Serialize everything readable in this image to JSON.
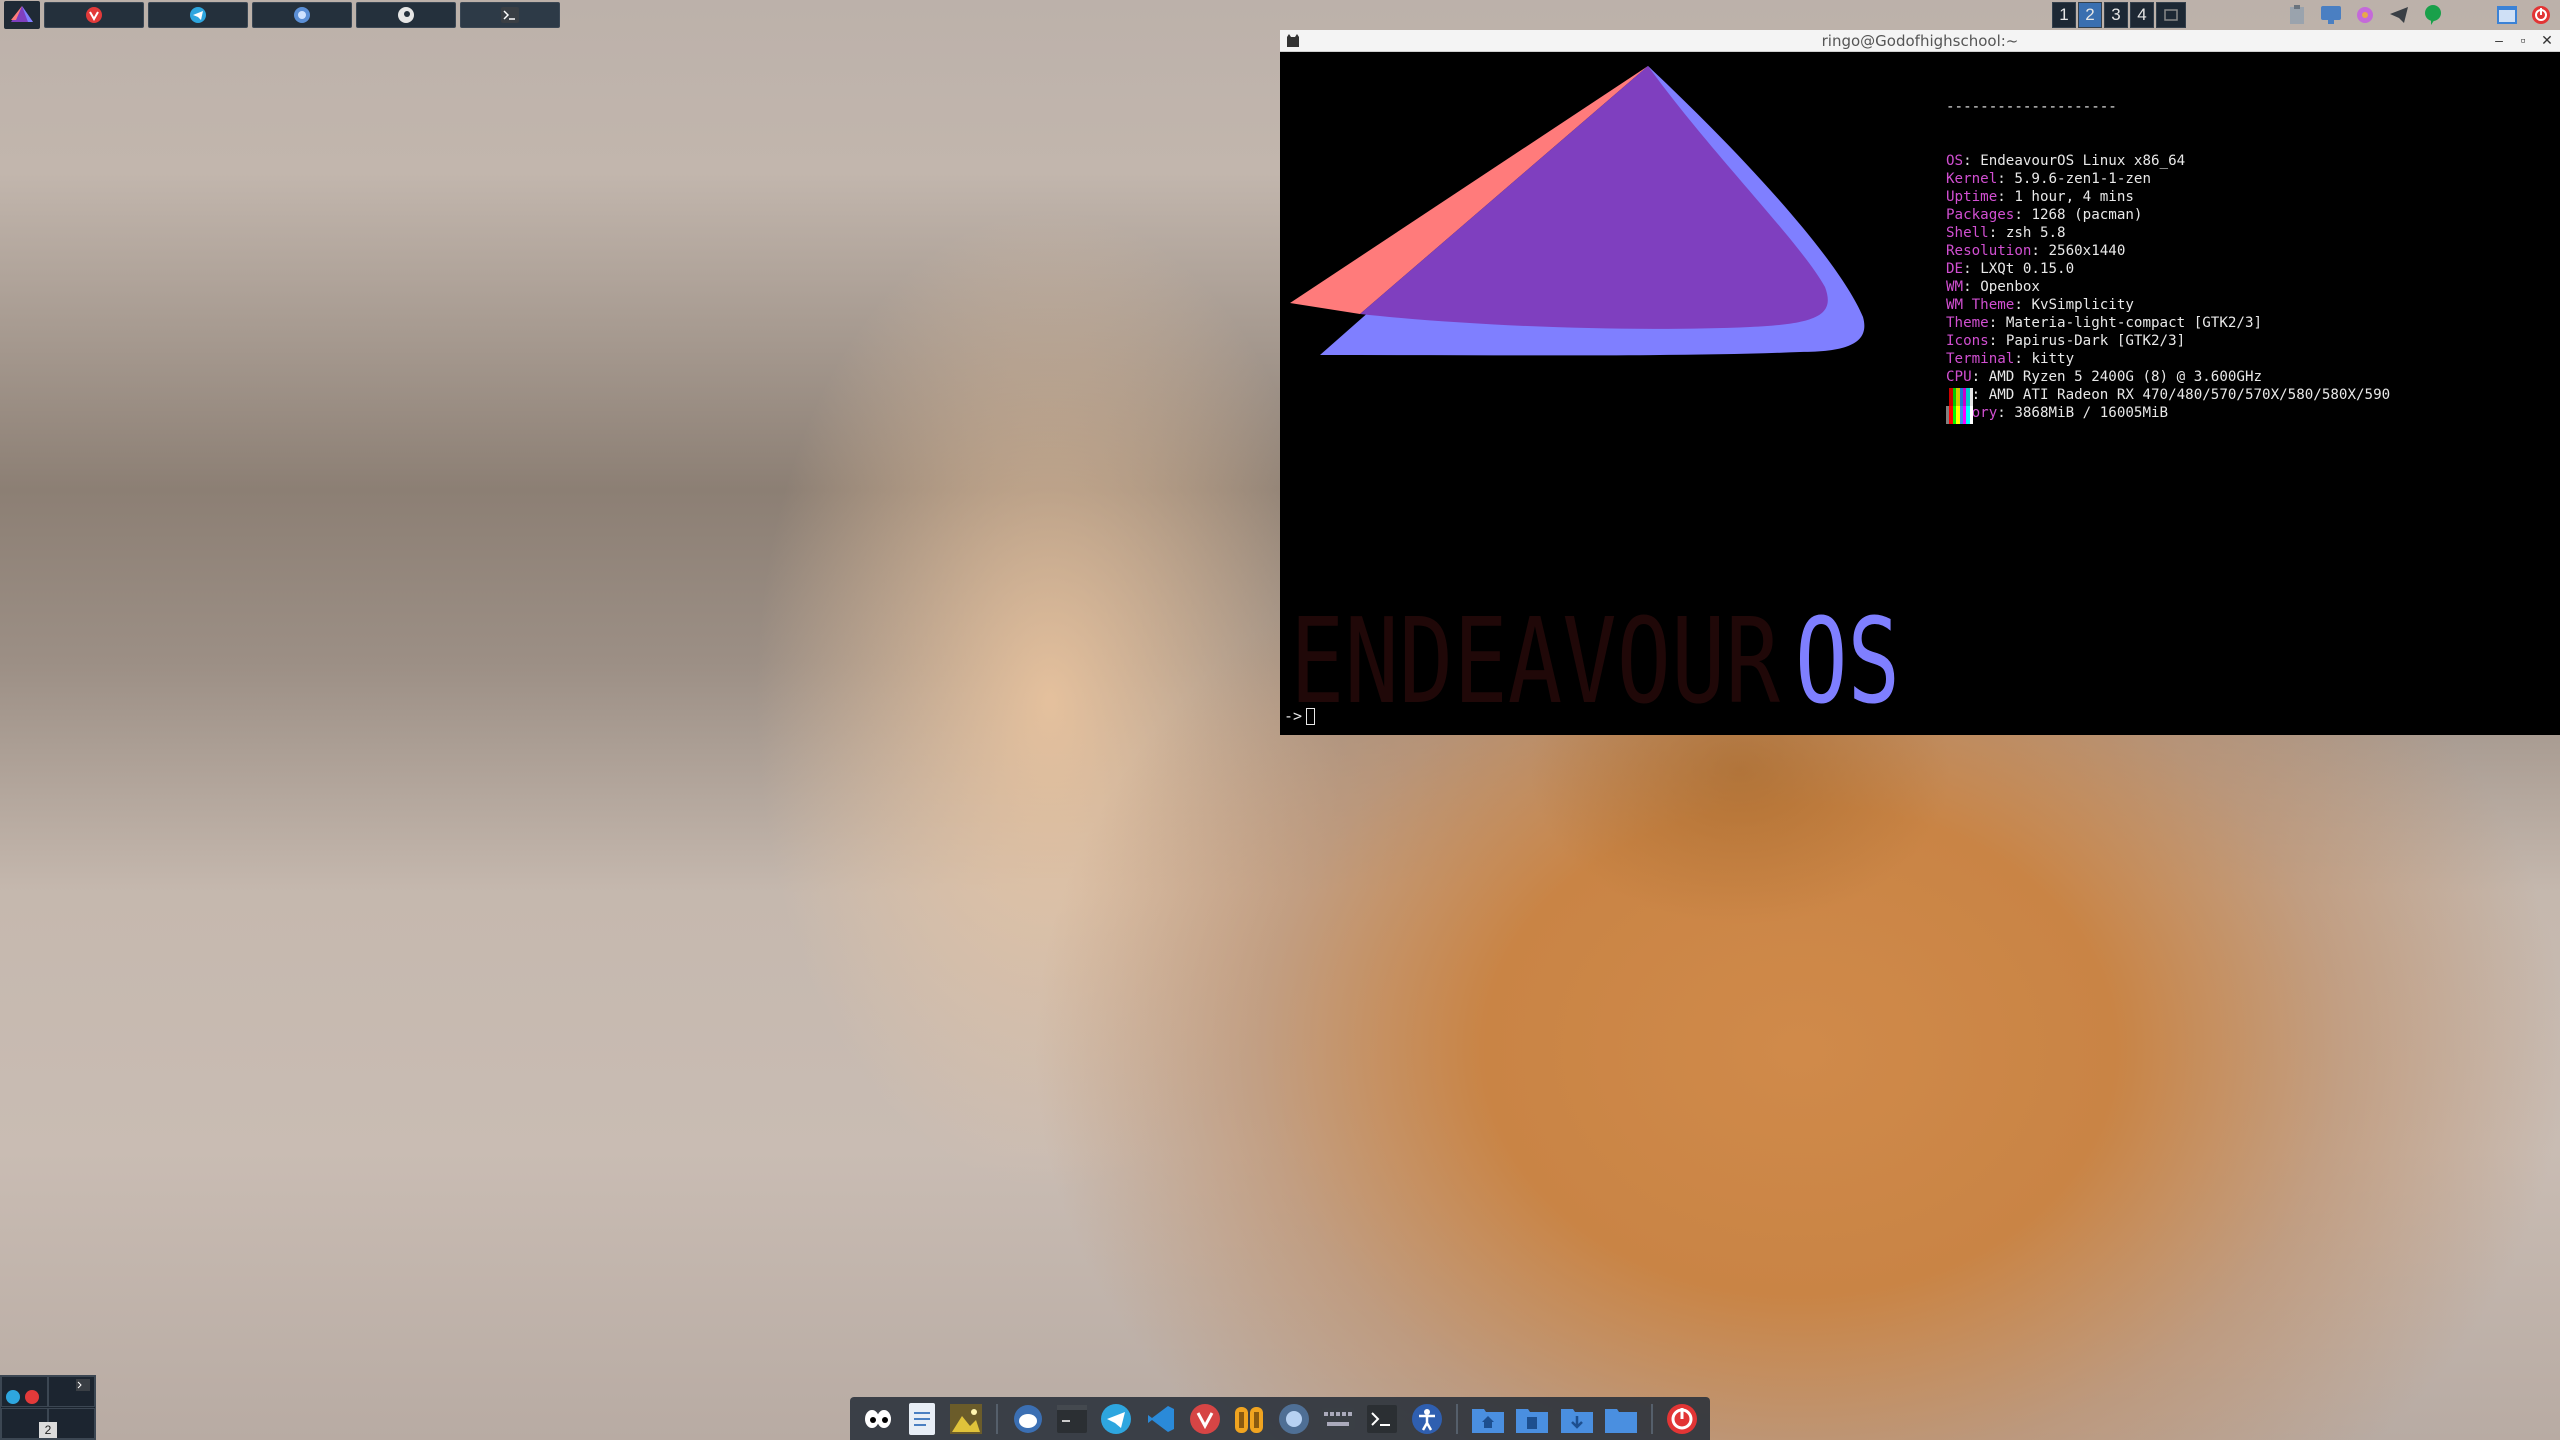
{
  "top_panel": {
    "tasks": [
      {
        "name": "vivaldi-task",
        "icon": "vivaldi-icon"
      },
      {
        "name": "telegram-task",
        "icon": "telegram-icon"
      },
      {
        "name": "browser-task",
        "icon": "globe-icon"
      },
      {
        "name": "steam-task",
        "icon": "steam-icon"
      },
      {
        "name": "terminal-task",
        "icon": "terminal-icon"
      }
    ],
    "desktops": [
      "1",
      "2",
      "3",
      "4"
    ],
    "active_desktop": "2"
  },
  "terminal": {
    "title": "ringo@Godofhighschool:~",
    "separator": "--------------------",
    "info": [
      {
        "key": "OS",
        "value": "EndeavourOS Linux x86_64"
      },
      {
        "key": "Kernel",
        "value": "5.9.6-zen1-1-zen"
      },
      {
        "key": "Uptime",
        "value": "1 hour, 4 mins"
      },
      {
        "key": "Packages",
        "value": "1268 (pacman)"
      },
      {
        "key": "Shell",
        "value": "zsh 5.8"
      },
      {
        "key": "Resolution",
        "value": "2560x1440"
      },
      {
        "key": "DE",
        "value": "LXQt 0.15.0"
      },
      {
        "key": "WM",
        "value": "Openbox"
      },
      {
        "key": "WM Theme",
        "value": "KvSimplicity"
      },
      {
        "key": "Theme",
        "value": "Materia-light-compact [GTK2/3]"
      },
      {
        "key": "Icons",
        "value": "Papirus-Dark [GTK2/3]"
      },
      {
        "key": "Terminal",
        "value": "kitty"
      },
      {
        "key": "CPU",
        "value": "AMD Ryzen 5 2400G (8) @ 3.600GHz"
      },
      {
        "key": "GPU",
        "value": "AMD ATI Radeon RX 470/480/570/570X/580/580X/590"
      },
      {
        "key": "Memory",
        "value": "3868MiB / 16005MiB"
      }
    ],
    "logo_text_dark": "ENDEAVOUR",
    "logo_text_blue": "OS",
    "prompt": "->",
    "palette_top": [
      "#000000",
      "#cc0000",
      "#00cc00",
      "#cccc00",
      "#1e78d6",
      "#cc00cc",
      "#00cccc",
      "#e6e6e6"
    ],
    "palette_bottom": [
      "#808080",
      "#ff0000",
      "#00ff00",
      "#ffff00",
      "#3b8eea",
      "#ff00ff",
      "#00ffff",
      "#ffffff"
    ]
  },
  "pager": {
    "current": "2"
  },
  "dock": {
    "icons": [
      "eyes-icon",
      "text-editor-icon",
      "image-viewer-icon",
      "mail-icon",
      "terminal-dark-icon",
      "telegram-icon",
      "vscode-icon",
      "vivaldi-icon",
      "books-icon",
      "browser-icon",
      "keyboard-icon",
      "terminal-icon",
      "accessibility-icon",
      "home-folder-icon",
      "documents-folder-icon",
      "downloads-folder-icon",
      "desktop-folder-icon",
      "power-icon"
    ]
  },
  "colors": {
    "logo_red": "#ff7b7b",
    "logo_purple": "#7f3fbf",
    "logo_blue": "#7f7fff",
    "info_key": "#d14fd1",
    "panel_bg": "#1f2a35"
  }
}
